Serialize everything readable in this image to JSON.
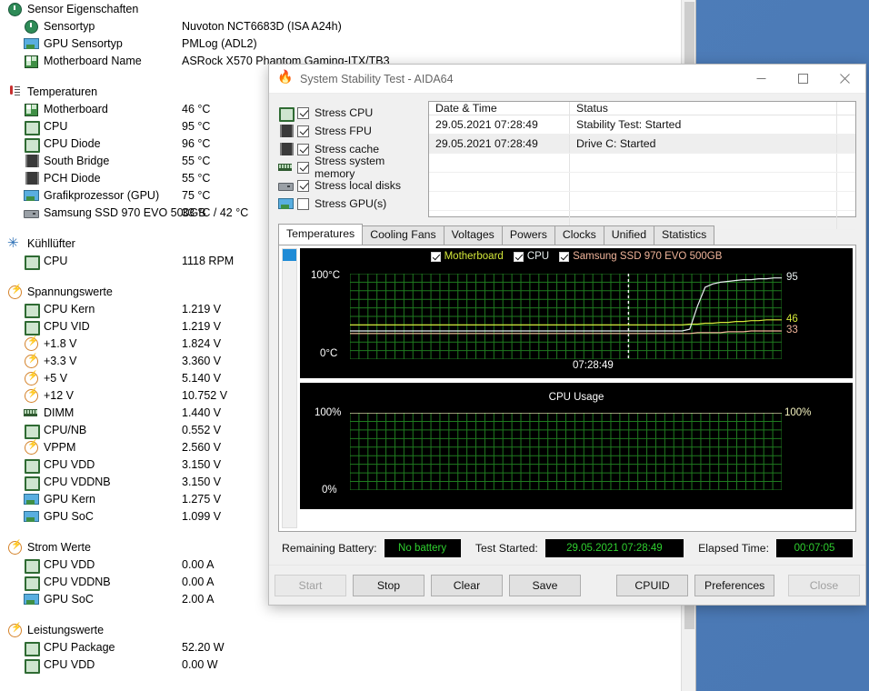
{
  "desktop": {
    "background_color": "#4a7ab8"
  },
  "sensor_panel": {
    "groups": [
      {
        "id": "sensor-properties",
        "icon": "sensor-icon",
        "label": "Sensor Eigenschaften",
        "rows": [
          {
            "icon": "sensor-icon",
            "label": "Sensortyp",
            "value": "Nuvoton NCT6683D  (ISA A24h)"
          },
          {
            "icon": "gpu-icon",
            "label": "GPU Sensortyp",
            "value": "PMLog  (ADL2)"
          },
          {
            "icon": "motherboard-icon",
            "label": "Motherboard Name",
            "value": "ASRock X570 Phantom Gaming-ITX/TB3"
          }
        ]
      },
      {
        "id": "temperatures",
        "icon": "thermometer-icon",
        "label": "Temperaturen",
        "rows": [
          {
            "icon": "motherboard-icon",
            "label": "Motherboard",
            "value": "46 °C"
          },
          {
            "icon": "cpu-icon",
            "label": "CPU",
            "value": "95 °C"
          },
          {
            "icon": "cpu-icon",
            "label": "CPU Diode",
            "value": "96 °C"
          },
          {
            "icon": "chip-icon",
            "label": "South Bridge",
            "value": "55 °C"
          },
          {
            "icon": "chip-icon",
            "label": "PCH Diode",
            "value": "55 °C"
          },
          {
            "icon": "gpu-icon",
            "label": "Grafikprozessor (GPU)",
            "value": "75 °C"
          },
          {
            "icon": "hdd-icon",
            "label": "Samsung SSD 970 EVO 500GB",
            "value": "33 °C / 42 °C"
          }
        ]
      },
      {
        "id": "cooling-fans",
        "icon": "fan-icon",
        "label": "Kühllüfter",
        "rows": [
          {
            "icon": "cpu-icon",
            "label": "CPU",
            "value": "1118 RPM"
          }
        ]
      },
      {
        "id": "voltage-values",
        "icon": "voltage-icon",
        "label": "Spannungswerte",
        "rows": [
          {
            "icon": "cpu-icon",
            "label": "CPU Kern",
            "value": "1.219 V"
          },
          {
            "icon": "cpu-icon",
            "label": "CPU VID",
            "value": "1.219 V"
          },
          {
            "icon": "voltage-icon",
            "label": "+1.8 V",
            "value": "1.824 V"
          },
          {
            "icon": "voltage-icon",
            "label": "+3.3 V",
            "value": "3.360 V"
          },
          {
            "icon": "voltage-icon",
            "label": "+5 V",
            "value": "5.140 V"
          },
          {
            "icon": "voltage-icon",
            "label": "+12 V",
            "value": "10.752 V"
          },
          {
            "icon": "dimm-icon",
            "label": "DIMM",
            "value": "1.440 V"
          },
          {
            "icon": "cpu-icon",
            "label": "CPU/NB",
            "value": "0.552 V"
          },
          {
            "icon": "voltage-icon",
            "label": "VPPM",
            "value": "2.560 V"
          },
          {
            "icon": "cpu-icon",
            "label": "CPU VDD",
            "value": "3.150 V"
          },
          {
            "icon": "cpu-icon",
            "label": "CPU VDDNB",
            "value": "3.150 V"
          },
          {
            "icon": "gpu-icon",
            "label": "GPU Kern",
            "value": "1.275 V"
          },
          {
            "icon": "gpu-icon",
            "label": "GPU SoC",
            "value": "1.099 V"
          }
        ]
      },
      {
        "id": "current-values",
        "icon": "voltage-icon",
        "label": "Strom Werte",
        "rows": [
          {
            "icon": "cpu-icon",
            "label": "CPU VDD",
            "value": "0.00 A"
          },
          {
            "icon": "cpu-icon",
            "label": "CPU VDDNB",
            "value": "0.00 A"
          },
          {
            "icon": "gpu-icon",
            "label": "GPU SoC",
            "value": "2.00 A"
          }
        ]
      },
      {
        "id": "power-values",
        "icon": "voltage-icon",
        "label": "Leistungswerte",
        "rows": [
          {
            "icon": "cpu-icon",
            "label": "CPU Package",
            "value": "52.20 W"
          },
          {
            "icon": "cpu-icon",
            "label": "CPU VDD",
            "value": "0.00 W"
          }
        ]
      }
    ]
  },
  "dialog": {
    "title": "System Stability Test - AIDA64",
    "title_icon": "aida64-flame-icon",
    "window_buttons": {
      "minimize": "minimize-icon",
      "maximize": "maximize-icon",
      "close": "close-icon"
    },
    "stress_options": [
      {
        "icon": "cpu-icon",
        "label": "Stress CPU",
        "checked": true
      },
      {
        "icon": "fpu-icon",
        "label": "Stress FPU",
        "checked": true
      },
      {
        "icon": "chip-icon",
        "label": "Stress cache",
        "checked": true
      },
      {
        "icon": "dimm-icon",
        "label": "Stress system memory",
        "checked": true
      },
      {
        "icon": "hdd-icon",
        "label": "Stress local disks",
        "checked": true
      },
      {
        "icon": "gpu-icon",
        "label": "Stress GPU(s)",
        "checked": false
      }
    ],
    "log_table": {
      "columns": [
        "Date & Time",
        "Status"
      ],
      "rows": [
        {
          "datetime": "29.05.2021 07:28:49",
          "status": "Stability Test: Started"
        },
        {
          "datetime": "29.05.2021 07:28:49",
          "status": "Drive C: Started"
        }
      ],
      "empty_rows": 4
    },
    "tabs": [
      {
        "label": "Temperatures",
        "active": true
      },
      {
        "label": "Cooling Fans",
        "active": false
      },
      {
        "label": "Voltages",
        "active": false
      },
      {
        "label": "Powers",
        "active": false
      },
      {
        "label": "Clocks",
        "active": false
      },
      {
        "label": "Unified",
        "active": false
      },
      {
        "label": "Statistics",
        "active": false
      }
    ],
    "status": {
      "battery_label": "Remaining Battery:",
      "battery_value": "No battery",
      "started_label": "Test Started:",
      "started_value": "29.05.2021 07:28:49",
      "elapsed_label": "Elapsed Time:",
      "elapsed_value": "00:07:05"
    },
    "buttons": [
      {
        "label": "Start",
        "disabled": true
      },
      {
        "label": "Stop",
        "disabled": false
      },
      {
        "label": "Clear",
        "disabled": false
      },
      {
        "label": "Save",
        "disabled": false
      },
      {
        "label": "CPUID",
        "disabled": false
      },
      {
        "label": "Preferences",
        "disabled": false
      },
      {
        "label": "Close",
        "disabled": true
      }
    ]
  },
  "chart_data": [
    {
      "type": "line",
      "id": "temperatures-chart",
      "title": "",
      "ylabel_top": "100°C",
      "ylabel_bottom": "0°C",
      "ylim": [
        0,
        100
      ],
      "xlabel": "",
      "x_marker_label": "07:28:49",
      "grid": true,
      "background": "#000000",
      "grid_color": "#1f7a1f",
      "legend_position": "top-center",
      "series": [
        {
          "name": "Motherboard",
          "color": "#d4e83a",
          "right_label": "46",
          "values": [
            40,
            40,
            40,
            40,
            40,
            40,
            40,
            40,
            41,
            41,
            42,
            42,
            43,
            43,
            44,
            44,
            45,
            45,
            46,
            46,
            46
          ]
        },
        {
          "name": "CPU",
          "color": "#e8f0f0",
          "right_label": "95",
          "values": [
            33,
            33,
            33,
            33,
            33,
            33,
            33,
            33,
            35,
            62,
            84,
            88,
            90,
            91,
            92,
            93,
            93,
            94,
            94,
            95,
            95
          ]
        },
        {
          "name": "Samsung SSD 970 EVO 500GB",
          "color": "#f0b49a",
          "right_label": "33",
          "values": [
            30,
            30,
            30,
            30,
            30,
            30,
            30,
            30,
            30,
            31,
            31,
            31,
            31,
            32,
            32,
            32,
            33,
            33,
            33,
            33,
            33
          ]
        }
      ]
    },
    {
      "type": "line",
      "id": "cpu-usage-chart",
      "title": "CPU Usage",
      "ylabel_top": "100%",
      "ylabel_bottom": "0%",
      "right_label": "100%",
      "ylim": [
        0,
        100
      ],
      "grid": true,
      "background": "#000000",
      "grid_color": "#1f7a1f",
      "series": [
        {
          "name": "CPU Usage",
          "color": "#f5f3c0",
          "values": [
            100,
            100,
            100,
            100,
            100,
            100,
            100,
            100,
            100,
            100,
            100,
            100,
            100,
            100,
            100,
            100,
            100,
            100,
            100,
            100,
            100
          ]
        }
      ]
    }
  ]
}
